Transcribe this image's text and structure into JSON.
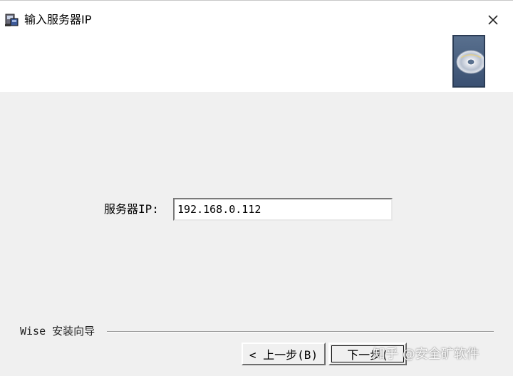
{
  "window": {
    "title": "输入服务器IP",
    "close_icon": "close-icon"
  },
  "form": {
    "server_ip_label": "服务器IP:",
    "server_ip_value": "192.168.0.112"
  },
  "footer": {
    "brand_label": "Wise 安装向导",
    "prev_button_label": "< 上一步(B)",
    "next_button_label": "下一步(",
    "watermark_text": "知乎 @安全矿软件"
  },
  "icons": {
    "app_icon": "installer-icon",
    "banner_icon": "cd-disc-icon"
  }
}
